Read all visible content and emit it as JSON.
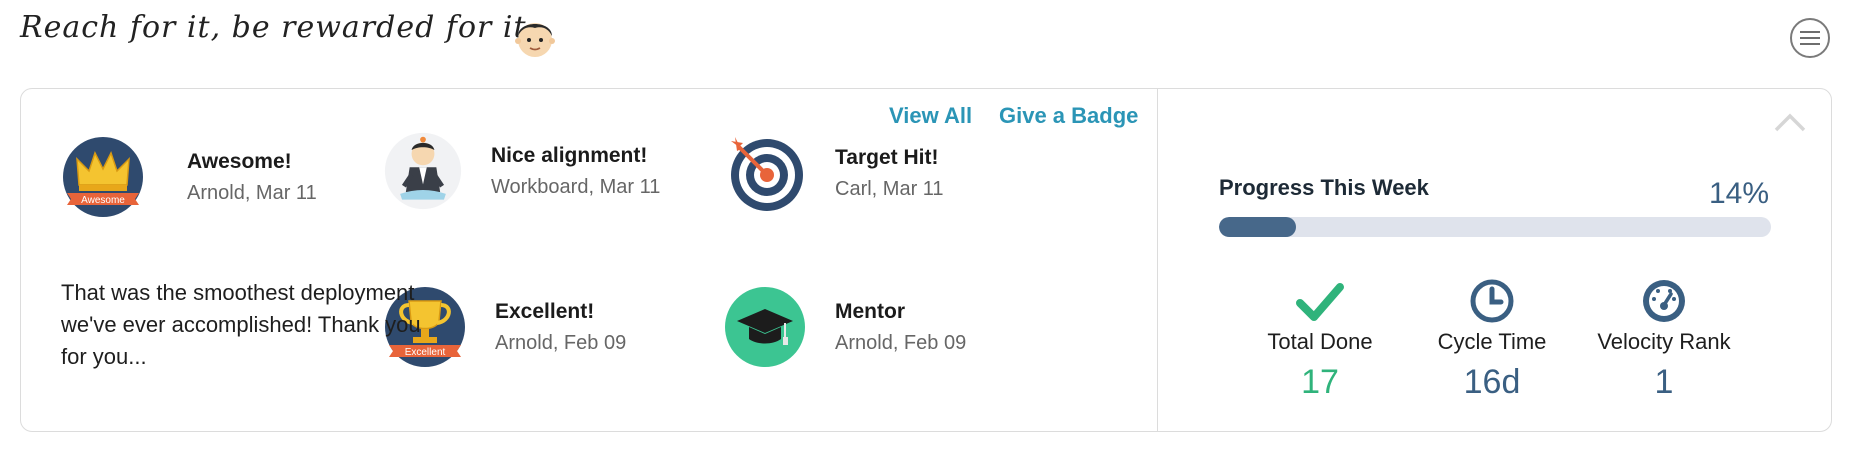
{
  "header": {
    "tagline": "Reach for it, be rewarded for it.",
    "avatar_icon": "avatar-face-icon",
    "menu_icon": "hamburger-menu-icon"
  },
  "links": {
    "view_all": "View All",
    "give_badge": "Give a Badge"
  },
  "badges": [
    {
      "title": "Awesome!",
      "meta": "Arnold, Mar 11",
      "icon": "crown-badge-icon",
      "ribbon": "Awesome"
    },
    {
      "title": "Nice alignment!",
      "meta": "Workboard, Mar 11",
      "icon": "meditating-person-icon"
    },
    {
      "title": "Target Hit!",
      "meta": "Carl, Mar 11",
      "icon": "target-icon"
    },
    {
      "title": "Excellent!",
      "meta": "Arnold, Feb 09",
      "icon": "trophy-badge-icon",
      "ribbon": "Excellent"
    },
    {
      "title": "Mentor",
      "meta": "Arnold, Feb 09",
      "icon": "graduation-cap-icon"
    }
  ],
  "message": "That was the smoothest deployment we've ever accomplished! Thank you for you...",
  "progress": {
    "title": "Progress This Week",
    "percent_label": "14%",
    "fraction": 0.14
  },
  "stats": [
    {
      "label": "Total Done",
      "value": "17",
      "icon": "checkmark-icon",
      "color": "#2fb37b"
    },
    {
      "label": "Cycle Time",
      "value": "16d",
      "icon": "clock-icon",
      "color": "#3a5f82"
    },
    {
      "label": "Velocity Rank",
      "value": "1",
      "icon": "speedometer-icon",
      "color": "#3a5f82"
    }
  ],
  "colors": {
    "accent_link": "#2b95b6",
    "progress_fill": "#47688a",
    "progress_track": "#dfe3ec",
    "success": "#2fb37b",
    "navy": "#2f4a6e"
  }
}
